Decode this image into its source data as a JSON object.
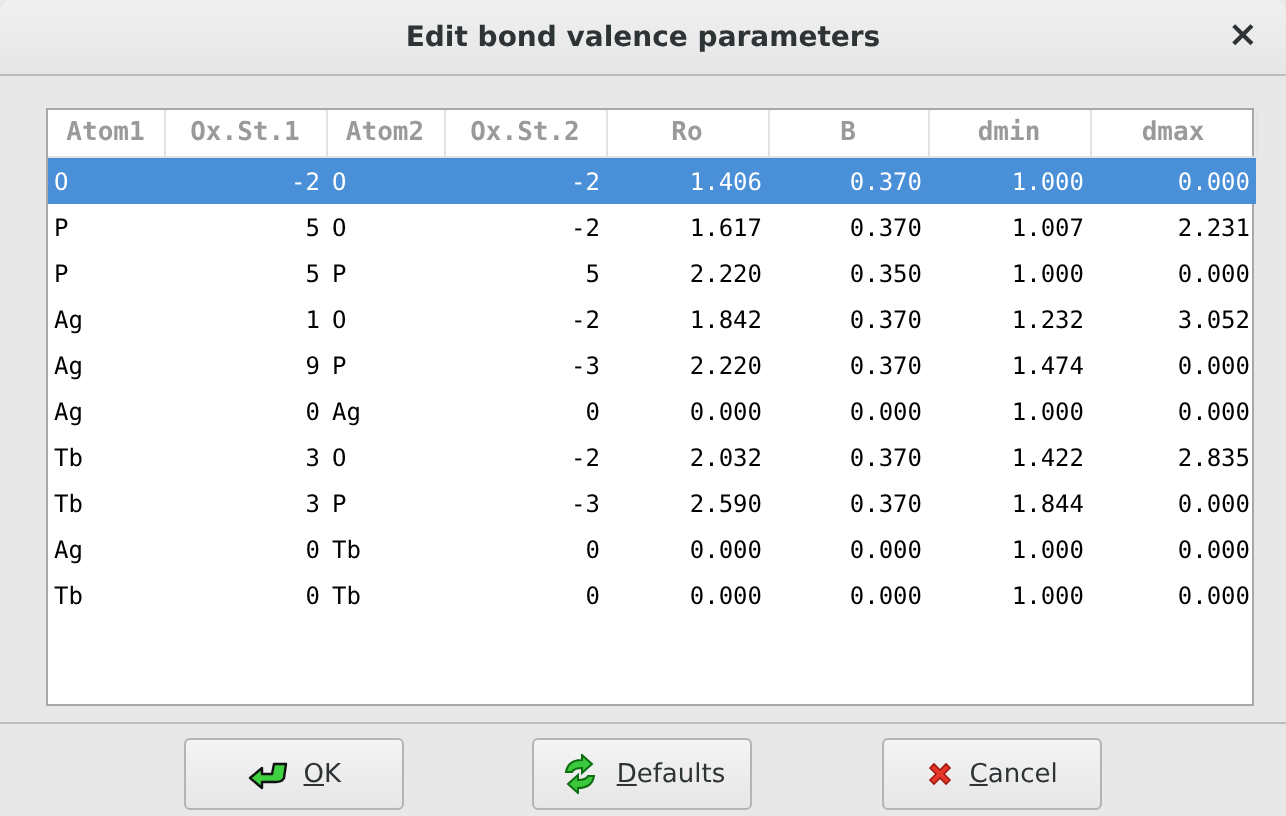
{
  "window": {
    "title": "Edit bond valence parameters",
    "close": "×"
  },
  "table": {
    "columns": [
      {
        "label": "Atom1"
      },
      {
        "label": "Ox.St.1"
      },
      {
        "label": "Atom2"
      },
      {
        "label": "Ox.St.2"
      },
      {
        "label": "Ro"
      },
      {
        "label": "B"
      },
      {
        "label": "dmin"
      },
      {
        "label": "dmax"
      }
    ],
    "rows": [
      {
        "selected": true,
        "cells": [
          "O",
          "-2",
          "O",
          "-2",
          "1.406",
          "0.370",
          "1.000",
          "0.000"
        ]
      },
      {
        "selected": false,
        "cells": [
          "P",
          "5",
          "O",
          "-2",
          "1.617",
          "0.370",
          "1.007",
          "2.231"
        ]
      },
      {
        "selected": false,
        "cells": [
          "P",
          "5",
          "P",
          "5",
          "2.220",
          "0.350",
          "1.000",
          "0.000"
        ]
      },
      {
        "selected": false,
        "cells": [
          "Ag",
          "1",
          "O",
          "-2",
          "1.842",
          "0.370",
          "1.232",
          "3.052"
        ]
      },
      {
        "selected": false,
        "cells": [
          "Ag",
          "9",
          "P",
          "-3",
          "2.220",
          "0.370",
          "1.474",
          "0.000"
        ]
      },
      {
        "selected": false,
        "cells": [
          "Ag",
          "0",
          "Ag",
          "0",
          "0.000",
          "0.000",
          "1.000",
          "0.000"
        ]
      },
      {
        "selected": false,
        "cells": [
          "Tb",
          "3",
          "O",
          "-2",
          "2.032",
          "0.370",
          "1.422",
          "2.835"
        ]
      },
      {
        "selected": false,
        "cells": [
          "Tb",
          "3",
          "P",
          "-3",
          "2.590",
          "0.370",
          "1.844",
          "0.000"
        ]
      },
      {
        "selected": false,
        "cells": [
          "Ag",
          "0",
          "Tb",
          "0",
          "0.000",
          "0.000",
          "1.000",
          "0.000"
        ]
      },
      {
        "selected": false,
        "cells": [
          "Tb",
          "0",
          "Tb",
          "0",
          "0.000",
          "0.000",
          "1.000",
          "0.000"
        ]
      }
    ]
  },
  "buttons": [
    {
      "kind": "ok",
      "label": "OK"
    },
    {
      "kind": "defaults",
      "label": "Defaults"
    },
    {
      "kind": "cancel",
      "label": "Cancel"
    }
  ]
}
